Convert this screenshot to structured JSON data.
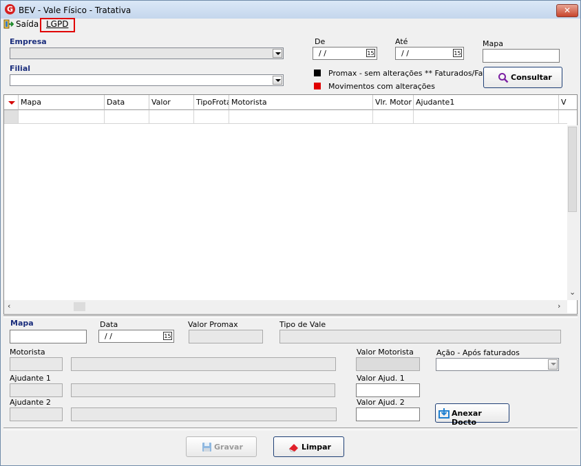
{
  "window": {
    "title": "BEV - Vale Físico - Tratativa",
    "close_symbol": "✕",
    "logo_letter": "G"
  },
  "menu": {
    "saida": "Saída",
    "lgpd": "LGPD"
  },
  "filters": {
    "empresa_label": "Empresa",
    "filial_label": "Filial",
    "de_label": "De",
    "ate_label": "Até",
    "mapa_label": "Mapa",
    "de_value": "/ /",
    "ate_value": "/ /",
    "cal_glyph": "15"
  },
  "legend": {
    "black_text": "Promax - sem alterações ** Faturados/Faturar",
    "red_text": "Movimentos com alterações",
    "black_color": "#000000",
    "red_color": "#e00000"
  },
  "consultar_label": "Consultar",
  "grid": {
    "columns": [
      "Mapa",
      "Data",
      "Valor",
      "TipoFrota",
      "Motorista",
      "Vlr. Motor",
      "Ajudante1",
      "V"
    ]
  },
  "details": {
    "mapa_label": "Mapa",
    "data_label": "Data",
    "data_value": "/ /",
    "valor_promax_label": "Valor Promax",
    "tipo_vale_label": "Tipo de Vale",
    "motorista_label": "Motorista",
    "valor_motorista_label": "Valor Motorista",
    "acao_label": "Ação - Após faturados",
    "ajudante1_label": "Ajudante 1",
    "valor_ajud1_label": "Valor Ajud. 1",
    "ajudante2_label": "Ajudante 2",
    "valor_ajud2_label": "Valor Ajud. 2",
    "anexar_label": "Anexar Docto"
  },
  "actions": {
    "gravar": "Gravar",
    "limpar": "Limpar"
  }
}
